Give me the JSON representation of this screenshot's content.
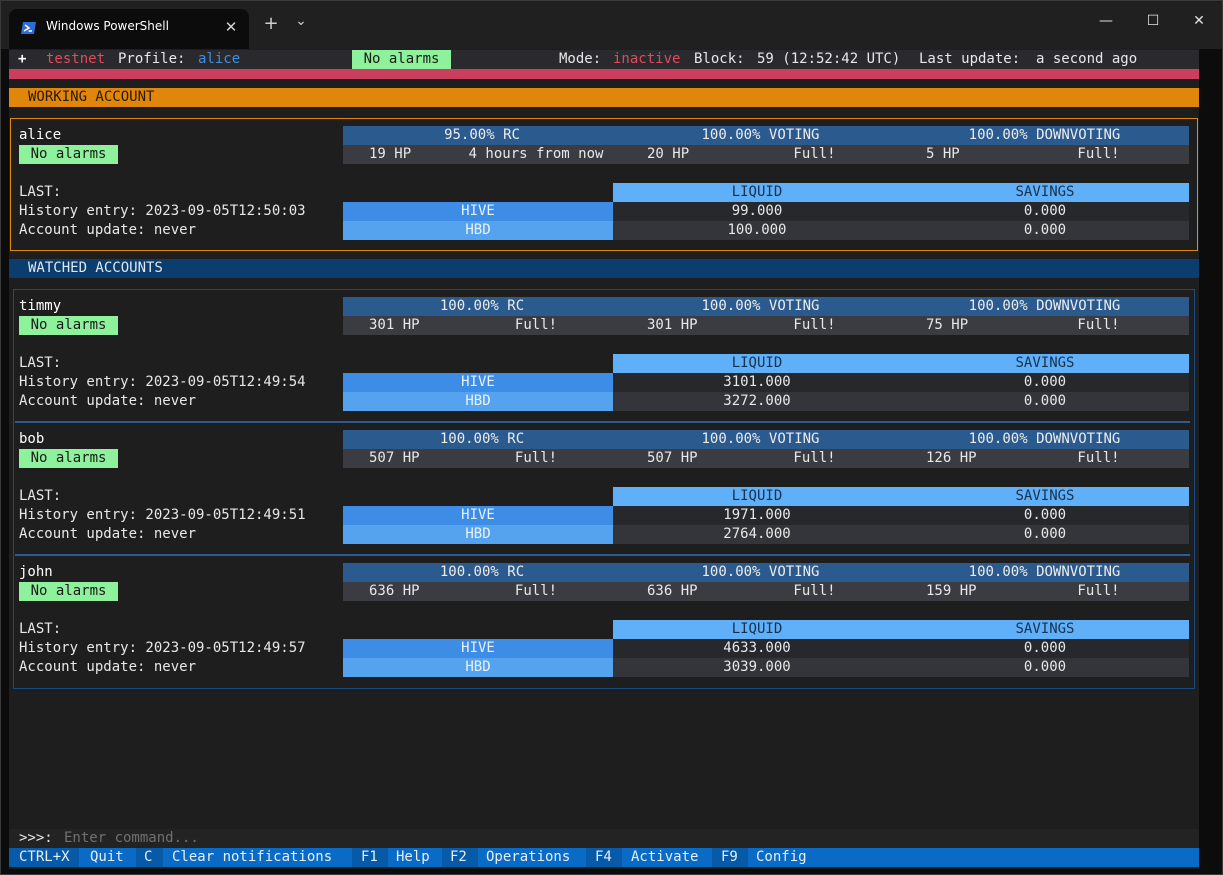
{
  "window": {
    "tab_title": "Windows PowerShell",
    "tab_close": "✕",
    "new_tab": "+",
    "dropdown": "⌄",
    "minimize": "—",
    "maximize": "☐",
    "close": "✕"
  },
  "status": {
    "plus": "+",
    "network": "testnet",
    "profile_label": "Profile:",
    "profile": "alice",
    "alarms": "No alarms",
    "mode_label": "Mode:",
    "mode": "inactive",
    "block_label": "Block:",
    "block": "59 (12:52:42 UTC)",
    "update_label": "Last update:",
    "update": "a second ago"
  },
  "working": {
    "heading": "WORKING ACCOUNT",
    "account": {
      "name": "alice",
      "alarms": "No alarms",
      "rc": {
        "head": "95.00% RC",
        "hp": "19 HP",
        "status": "4 hours from now"
      },
      "voting": {
        "head": "100.00% VOTING",
        "hp": "20 HP",
        "status": "Full!"
      },
      "downvoting": {
        "head": "100.00% DOWNVOTING",
        "hp": "5 HP",
        "status": "Full!"
      },
      "last": "LAST:",
      "history": "History entry: 2023-09-05T12:50:03",
      "account_update": "Account update: never",
      "liquid": "LIQUID",
      "savings": "SAVINGS",
      "hive_label": "HIVE",
      "hbd_label": "HBD",
      "hive_liquid": "99.000",
      "hive_savings": "0.000",
      "hbd_liquid": "100.000",
      "hbd_savings": "0.000"
    }
  },
  "watched": {
    "heading": "WATCHED ACCOUNTS",
    "accounts": [
      {
        "name": "timmy",
        "alarms": "No alarms",
        "rc": {
          "head": "100.00% RC",
          "hp": "301 HP",
          "status": "Full!"
        },
        "voting": {
          "head": "100.00% VOTING",
          "hp": "301 HP",
          "status": "Full!"
        },
        "downvoting": {
          "head": "100.00% DOWNVOTING",
          "hp": "75 HP",
          "status": "Full!"
        },
        "last": "LAST:",
        "history": "History entry: 2023-09-05T12:49:54",
        "account_update": "Account update: never",
        "liquid": "LIQUID",
        "savings": "SAVINGS",
        "hive_label": "HIVE",
        "hbd_label": "HBD",
        "hive_liquid": "3101.000",
        "hive_savings": "0.000",
        "hbd_liquid": "3272.000",
        "hbd_savings": "0.000"
      },
      {
        "name": "bob",
        "alarms": "No alarms",
        "rc": {
          "head": "100.00% RC",
          "hp": "507 HP",
          "status": "Full!"
        },
        "voting": {
          "head": "100.00% VOTING",
          "hp": "507 HP",
          "status": "Full!"
        },
        "downvoting": {
          "head": "100.00% DOWNVOTING",
          "hp": "126 HP",
          "status": "Full!"
        },
        "last": "LAST:",
        "history": "History entry: 2023-09-05T12:49:51",
        "account_update": "Account update: never",
        "liquid": "LIQUID",
        "savings": "SAVINGS",
        "hive_label": "HIVE",
        "hbd_label": "HBD",
        "hive_liquid": "1971.000",
        "hive_savings": "0.000",
        "hbd_liquid": "2764.000",
        "hbd_savings": "0.000"
      },
      {
        "name": "john",
        "alarms": "No alarms",
        "rc": {
          "head": "100.00% RC",
          "hp": "636 HP",
          "status": "Full!"
        },
        "voting": {
          "head": "100.00% VOTING",
          "hp": "636 HP",
          "status": "Full!"
        },
        "downvoting": {
          "head": "100.00% DOWNVOTING",
          "hp": "159 HP",
          "status": "Full!"
        },
        "last": "LAST:",
        "history": "History entry: 2023-09-05T12:49:57",
        "account_update": "Account update: never",
        "liquid": "LIQUID",
        "savings": "SAVINGS",
        "hive_label": "HIVE",
        "hbd_label": "HBD",
        "hive_liquid": "4633.000",
        "hive_savings": "0.000",
        "hbd_liquid": "3039.000",
        "hbd_savings": "0.000"
      }
    ]
  },
  "command": {
    "prompt": ">>>:",
    "placeholder": "Enter command..."
  },
  "keys": [
    {
      "key": "CTRL+X",
      "label": "Quit"
    },
    {
      "key": "C",
      "label": "Clear notifications"
    },
    {
      "key": "F1",
      "label": "Help"
    },
    {
      "key": "F2",
      "label": "Operations"
    },
    {
      "key": "F4",
      "label": "Activate"
    },
    {
      "key": "F9",
      "label": "Config"
    }
  ],
  "colors": {
    "status_red": "#e24a5d",
    "profile_blue": "#3c8fe0",
    "working_orange": "#e0860a",
    "watched_blue": "#0b3d6e",
    "alarm_green": "#8ef29c"
  }
}
